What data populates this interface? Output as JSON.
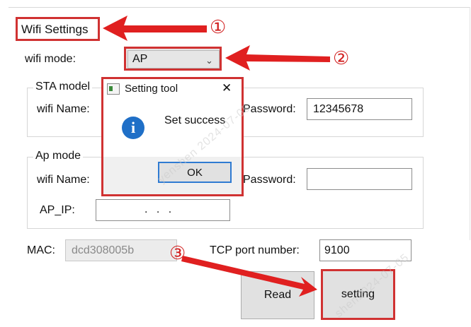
{
  "window": {
    "tab_title": "Wifi Settings"
  },
  "wifi_mode": {
    "label": "wifi mode:",
    "value": "AP"
  },
  "sta_group": {
    "title": "STA model",
    "wifi_name_label": "wifi Name:",
    "password_label": "Password:",
    "password_value": "12345678"
  },
  "ap_group": {
    "title": "Ap mode",
    "wifi_name_label": "wifi Name:",
    "password_label": "Password:",
    "password_value": "",
    "ip_label": "AP_IP:",
    "ip_value": ". . ."
  },
  "mac": {
    "label": "MAC:",
    "value": "dcd308005b"
  },
  "tcp": {
    "label": "TCP port number:",
    "value": "9100"
  },
  "buttons": {
    "read": "Read",
    "setting": "setting"
  },
  "dialog": {
    "title": "Setting tool",
    "close": "✕",
    "message": "Set success",
    "ok": "OK",
    "icon_glyph": "i"
  },
  "annotations": {
    "one": "①",
    "two": "②",
    "three": "③"
  },
  "watermark": {
    "text_a": "yenshen 2024-07-05",
    "text_b": "shen2024-07-05"
  },
  "colors": {
    "highlight": "#d03232",
    "arrow": "#e02020",
    "info_icon": "#1f6fc7",
    "focus": "#2f7bd2"
  }
}
